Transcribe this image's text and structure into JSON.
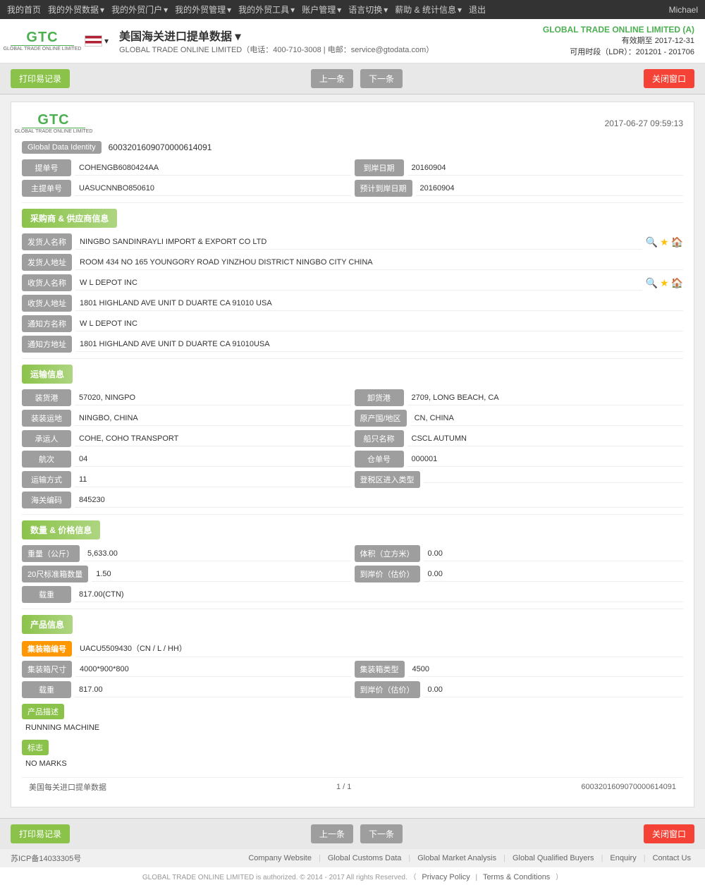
{
  "nav": {
    "items": [
      {
        "label": "我的首页",
        "hasDropdown": false
      },
      {
        "label": "我的外贸数据",
        "hasDropdown": true
      },
      {
        "label": "我的外贸门户",
        "hasDropdown": true
      },
      {
        "label": "我的外贸管理",
        "hasDropdown": true
      },
      {
        "label": "我的外贸工具",
        "hasDropdown": true
      },
      {
        "label": "账户管理",
        "hasDropdown": true
      },
      {
        "label": "语言切换",
        "hasDropdown": true
      },
      {
        "label": "薪助 & 统计信息",
        "hasDropdown": true
      },
      {
        "label": "退出",
        "hasDropdown": false
      }
    ],
    "user": "Michael"
  },
  "header": {
    "logo_text": "GTC",
    "logo_sub": "GLOBAL TRADE ONLINE LIMITED",
    "page_title": "美国海关进口提单数据",
    "page_subtitle": "GLOBAL TRADE ONLINE LIMITED（电话：400-710-3008 | 电邮：service@gtodata.com）",
    "company_name": "GLOBAL TRADE ONLINE LIMITED (A)",
    "expiry_label": "有效期至",
    "expiry_date": "2017-12-31",
    "ldr_label": "可用时段（LDR）：201201 - 201706"
  },
  "toolbar": {
    "print_btn": "打印易记录",
    "prev_btn": "上一条",
    "next_btn": "下一条",
    "close_btn": "关闭窗口"
  },
  "record": {
    "timestamp": "2017-06-27  09:59:13",
    "gdi_label": "Global Data Identity",
    "gdi_value": "60032016090700006​14091",
    "bill_no_label": "提单号",
    "bill_no_value": "COHENGB6080424AA",
    "arrival_date_label": "到岸日期",
    "arrival_date_value": "20160904",
    "master_bill_label": "主提单号",
    "master_bill_value": "UASUCNNBO850610",
    "estimated_arrival_label": "预计到岸日期",
    "estimated_arrival_value": "20160904",
    "section_supplier": "采购商 & 供应商信息",
    "shipper_name_label": "发货人名称",
    "shipper_name_value": "NINGBO SANDINRAYLI IMPORT & EXPORT CO LTD",
    "shipper_addr_label": "发货人地址",
    "shipper_addr_value": "ROOM 434 NO 165 YOUNGORY ROAD YINZHOU DISTRICT NINGBO CITY CHINA",
    "consignee_name_label": "收货人名称",
    "consignee_name_value": "W L DEPOT INC",
    "consignee_addr_label": "收货人地址",
    "consignee_addr_value": "1801 HIGHLAND AVE UNIT D DUARTE CA 91010 USA",
    "notify_name_label": "通知方名称",
    "notify_name_value": "W L DEPOT INC",
    "notify_addr_label": "通知方地址",
    "notify_addr_value": "1801 HIGHLAND AVE UNIT D DUARTE CA 91010USA",
    "section_transport": "运输信息",
    "loading_port_label": "装货港",
    "loading_port_value": "57020, NINGPO",
    "discharge_port_label": "卸货港",
    "discharge_port_value": "2709, LONG BEACH, CA",
    "loading_place_label": "装装运地",
    "loading_place_value": "NINGBO, CHINA",
    "origin_country_label": "原产国/地区",
    "origin_country_value": "CN, CHINA",
    "carrier_label": "承运人",
    "carrier_value": "COHE, COHO TRANSPORT",
    "vessel_name_label": "船只名称",
    "vessel_name_value": "CSCL AUTUMN",
    "voyage_label": "航次",
    "voyage_value": "04",
    "warehouse_no_label": "仓单号",
    "warehouse_no_value": "000001",
    "transport_mode_label": "运输方式",
    "transport_mode_value": "11",
    "ftz_entry_label": "登税区进入类型",
    "ftz_entry_value": "",
    "customs_code_label": "海关编码",
    "customs_code_value": "845230",
    "section_quantity": "数量 & 价格信息",
    "weight_label": "重量（公斤）",
    "weight_value": "5,633.00",
    "volume_label": "体积（立方米）",
    "volume_value": "0.00",
    "container20_label": "20尺标准箱数量",
    "container20_value": "1.50",
    "arrival_price_label": "到岸价（估价）",
    "arrival_price_value": "0.00",
    "qty_label": "载重",
    "qty_value": "817.00(CTN)",
    "section_product": "产品信息",
    "container_no_label": "集装箱编号",
    "container_no_value": "UACU5509430（CN / L / HH）",
    "container_size_label": "集装箱尺寸",
    "container_size_value": "4000*900*800",
    "container_type_label": "集装箱类型",
    "container_type_value": "4500",
    "product_qty_label": "载重",
    "product_qty_value": "817.00",
    "product_price_label": "到岸价（估价）",
    "product_price_value": "0.00",
    "product_desc_label": "产品描述",
    "product_desc_value": "RUNNING MACHINE",
    "marks_label": "标志",
    "marks_value": "NO MARKS"
  },
  "pagination": {
    "dataset_label": "美国每关进口提单数据",
    "page_info": "1 / 1",
    "record_id": "60032016090700006​14091"
  },
  "footer": {
    "icp": "苏ICP备14033305号",
    "links": [
      {
        "label": "Company Website"
      },
      {
        "label": "Global Customs Data"
      },
      {
        "label": "Global Market Analysis"
      },
      {
        "label": "Global Qualified Buyers"
      },
      {
        "label": "Enquiry"
      },
      {
        "label": "Contact Us"
      }
    ],
    "copyright": "GLOBAL TRADE ONLINE LIMITED is authorized. © 2014 - 2017 All rights Reserved.",
    "privacy": "Privacy Policy",
    "terms": "Terms & Conditions"
  }
}
